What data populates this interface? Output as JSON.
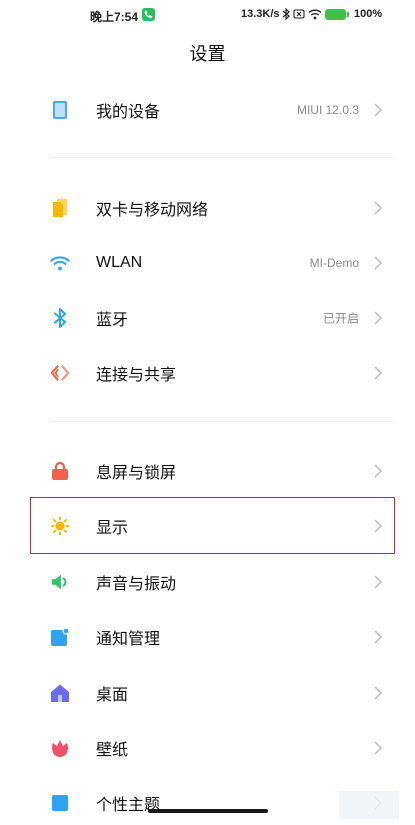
{
  "status_bar": {
    "time": "晚上7:54",
    "speed": "13.3K/s",
    "battery": "100%",
    "battery_level": 1.0,
    "call_color": "#22c15e",
    "battery_color": "#3ec14a"
  },
  "header": {
    "title": "设置"
  },
  "items": [
    {
      "id": "my-device",
      "label": "我的设备",
      "value": "MIUI 12.0.3",
      "icon": "phone-device-icon",
      "color": "#4aa8f0"
    },
    {
      "id": "dual-sim",
      "label": "双卡与移动网络",
      "value": "",
      "icon": "sim-card-icon",
      "color": "#f5b800"
    },
    {
      "id": "wlan",
      "label": "WLAN",
      "value": "MI-Demo",
      "icon": "wifi-icon",
      "color": "#2ea3f2"
    },
    {
      "id": "bluetooth",
      "label": "蓝牙",
      "value": "已开启",
      "icon": "bluetooth-icon",
      "color": "#2ea3f2"
    },
    {
      "id": "connection-sharing",
      "label": "连接与共享",
      "value": "",
      "icon": "connection-share-icon",
      "color": "#f06a4a"
    },
    {
      "id": "lock-screen",
      "label": "息屏与锁屏",
      "value": "",
      "icon": "lock-icon",
      "color": "#f0604a"
    },
    {
      "id": "display",
      "label": "显示",
      "value": "",
      "icon": "sun-icon",
      "color": "#f7b900"
    },
    {
      "id": "sound",
      "label": "声音与振动",
      "value": "",
      "icon": "speaker-icon",
      "color": "#2ec46a"
    },
    {
      "id": "notifications",
      "label": "通知管理",
      "value": "",
      "icon": "notification-icon",
      "color": "#2ea3f2"
    },
    {
      "id": "desktop",
      "label": "桌面",
      "value": "",
      "icon": "home-icon",
      "color": "#6b6bf0"
    },
    {
      "id": "wallpaper",
      "label": "壁纸",
      "value": "",
      "icon": "flower-icon",
      "color": "#f0506a"
    },
    {
      "id": "themes",
      "label": "个性主题",
      "value": "",
      "icon": "theme-icon",
      "color": "#2ea3f2"
    }
  ],
  "chevron_color": "#b8b8b8",
  "highlight_color": "#c62828"
}
